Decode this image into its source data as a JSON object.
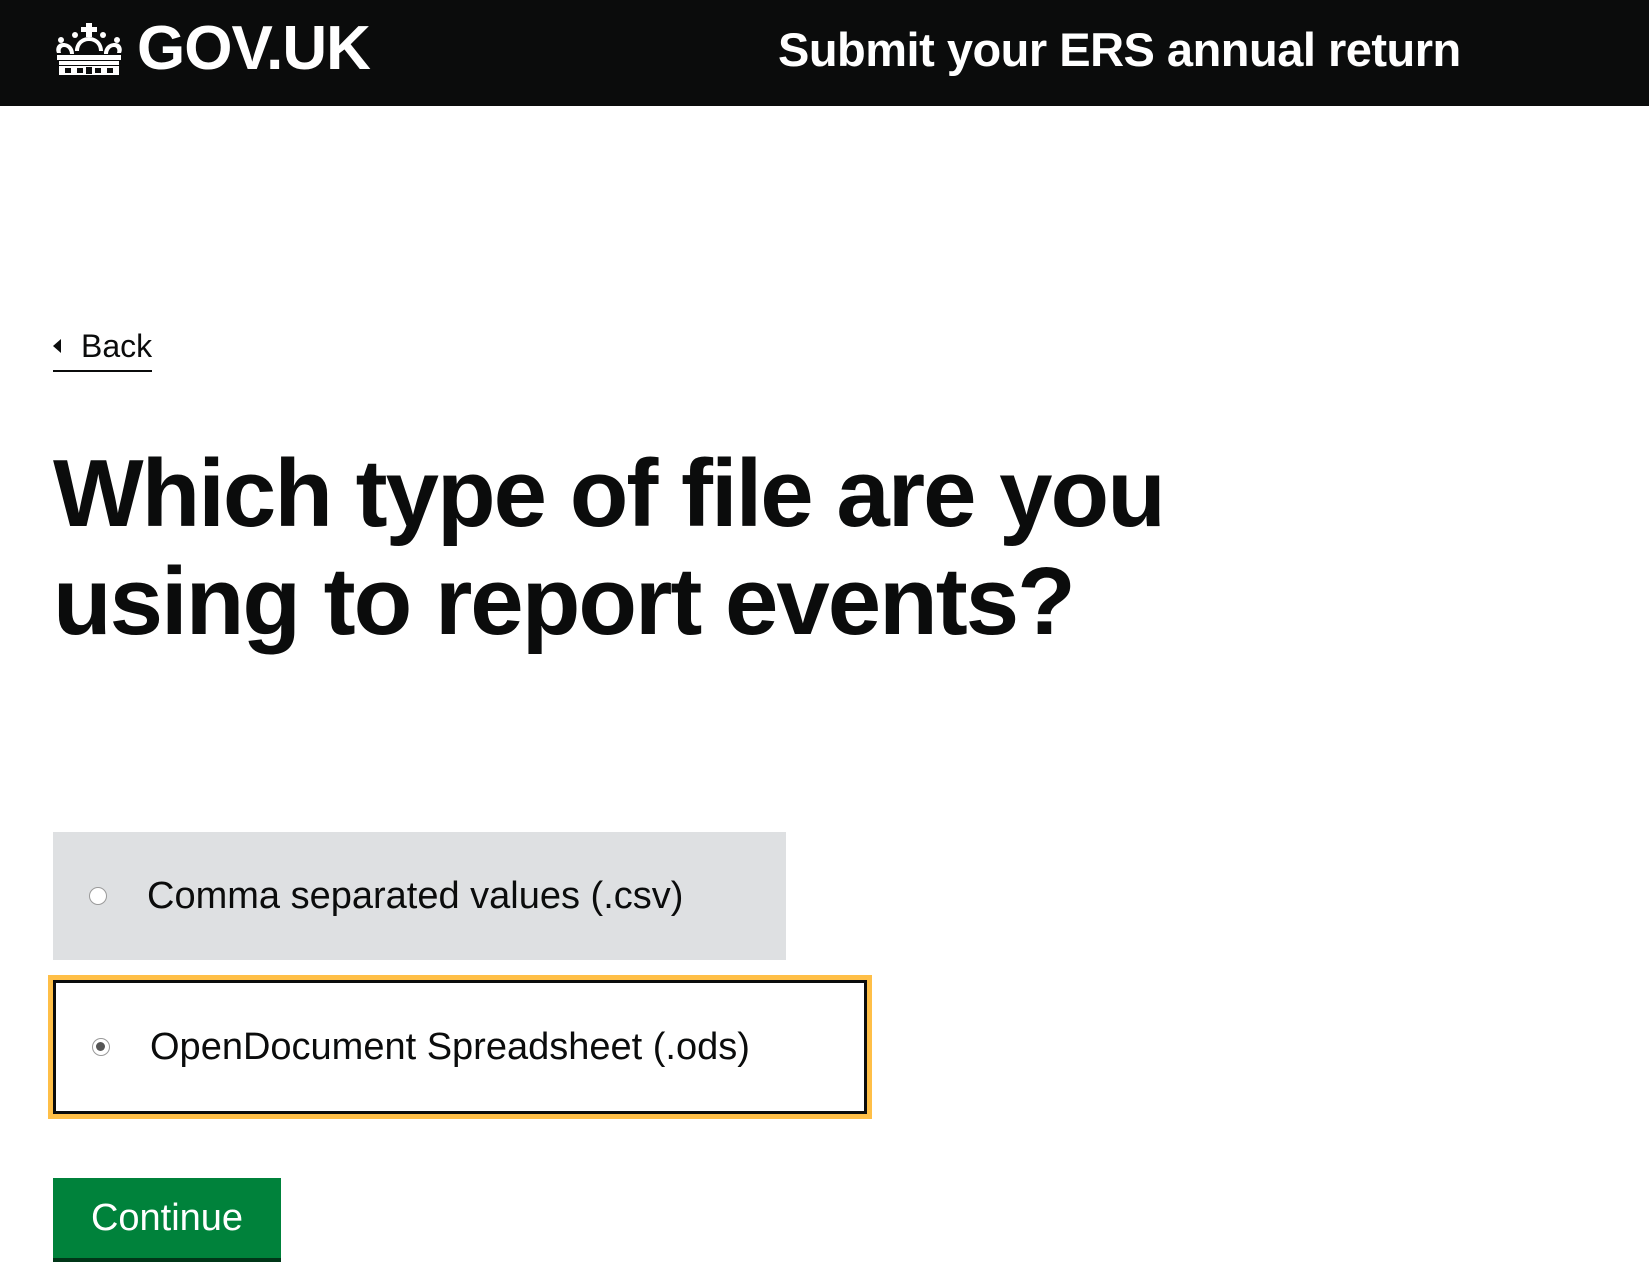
{
  "header": {
    "logo_text": "GOV.UK",
    "logo_icon": "crown-icon",
    "service_name": "Submit your ERS annual return"
  },
  "back_link": {
    "label": "Back",
    "icon": "chevron-left-icon"
  },
  "page_title": "Which type of file are you using to report events?",
  "file_type_options": [
    {
      "label": "Comma separated values (.csv)",
      "selected": false
    },
    {
      "label": "OpenDocument Spreadsheet (.ods)",
      "selected": true
    }
  ],
  "continue_button": {
    "label": "Continue"
  },
  "colors": {
    "header_bg": "#0b0c0c",
    "button_green": "#00823b",
    "focus_yellow": "#ffbf47",
    "hover_grey": "#dee0e2"
  }
}
